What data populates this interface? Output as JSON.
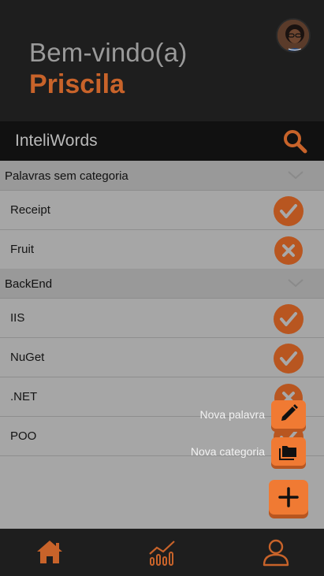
{
  "header": {
    "welcome": "Bem-vindo(a)",
    "user_name": "Priscila",
    "avatar_icon": "user-avatar-photo"
  },
  "appbar": {
    "title": "InteliWords",
    "search_icon": "search-icon"
  },
  "categories": [
    {
      "title": "Palavras sem categoria",
      "words": [
        {
          "label": "Receipt",
          "status": "correct"
        },
        {
          "label": "Fruit",
          "status": "wrong"
        }
      ]
    },
    {
      "title": "BackEnd",
      "words": [
        {
          "label": "IIS",
          "status": "correct"
        },
        {
          "label": "NuGet",
          "status": "correct"
        },
        {
          "label": ".NET",
          "status": "wrong"
        },
        {
          "label": "POO",
          "status": "correct"
        }
      ]
    }
  ],
  "fab_menu": {
    "new_word_label": "Nova palavra",
    "new_category_label": "Nova categoria",
    "new_word_icon": "pencil-icon",
    "new_category_icon": "folder-icon",
    "main_icon": "plus-icon"
  },
  "bottom_nav": {
    "items": [
      {
        "icon": "home-icon"
      },
      {
        "icon": "chart-icon"
      },
      {
        "icon": "profile-icon"
      }
    ]
  },
  "colors": {
    "accent": "#c8632a",
    "accent_fab": "#f07a33",
    "status_bg": "#b85620",
    "header_bg": "#1e1e1e",
    "overlay_list_bg": "#a6a6a6"
  }
}
